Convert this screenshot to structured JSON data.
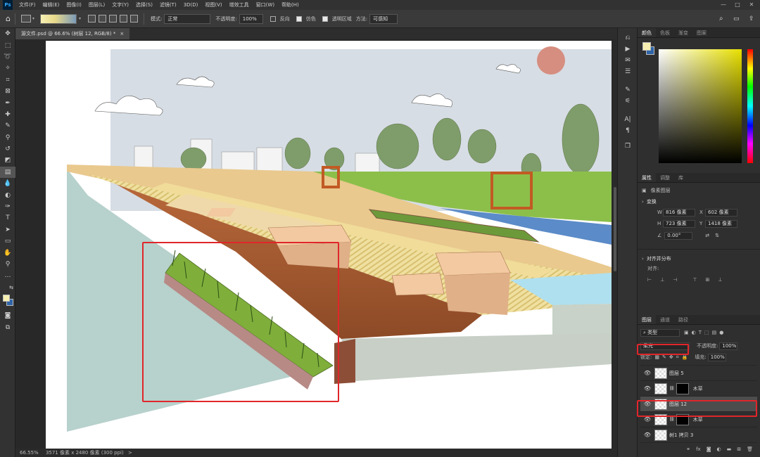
{
  "menubar": {
    "logo": "Ps",
    "items": [
      "文件(F)",
      "编辑(E)",
      "图像(I)",
      "图层(L)",
      "文字(Y)",
      "选择(S)",
      "滤镜(T)",
      "3D(D)",
      "视图(V)",
      "增效工具",
      "窗口(W)",
      "帮助(H)"
    ]
  },
  "options": {
    "mode_label": "模式:",
    "mode_value": "正常",
    "opacity_label": "不透明度:",
    "opacity_value": "100%",
    "reverse_label": "反向",
    "dither_label": "仿色",
    "transparency_label": "透明区域",
    "method_label": "方法:",
    "method_value": "可感知"
  },
  "document": {
    "tab_title": "源文件.psd @ 66.6% (树层 12, RGB/8) *",
    "close_glyph": "×"
  },
  "status": {
    "zoom": "66.55%",
    "size": "3571 像素 x 2480 像素 (300 ppi)",
    "arrow": ">"
  },
  "colors": {
    "foreground": "#f6efb0",
    "background": "#2e64a8",
    "highlight": "#e0262b"
  },
  "swatch_panel": {
    "tabs": [
      "颜色",
      "色板",
      "渐变",
      "图案"
    ],
    "active_tab": 0
  },
  "properties_panel": {
    "tabs": [
      "属性",
      "调整",
      "库"
    ],
    "active_tab": 0,
    "kind": "像素图层",
    "transform_title": "变换",
    "w_label": "W",
    "w_value": "816 像素",
    "x_label": "X",
    "x_value": "602 像素",
    "h_label": "H",
    "h_value": "723 像素",
    "y_label": "Y",
    "y_value": "1418 像素",
    "angle_value": "0.00°",
    "align_title": "对齐并分布",
    "align_sub": "对齐:"
  },
  "layers_panel": {
    "tabs": [
      "图层",
      "通道",
      "路径"
    ],
    "active_tab": 0,
    "filter_label": "类型",
    "blend_mode": "柔光",
    "opacity_label": "不透明度:",
    "opacity_value": "100%",
    "lock_label": "锁定:",
    "fill_label": "填充:",
    "fill_value": "100%",
    "layers": [
      {
        "name": "图层 5",
        "mask": false,
        "selected": false
      },
      {
        "name": "木草",
        "mask": true,
        "selected": false
      },
      {
        "name": "图层 12",
        "mask": false,
        "selected": true
      },
      {
        "name": "木草",
        "mask": true,
        "selected": false
      },
      {
        "name": "树1 拷贝 3",
        "mask": false,
        "selected": false
      }
    ]
  }
}
